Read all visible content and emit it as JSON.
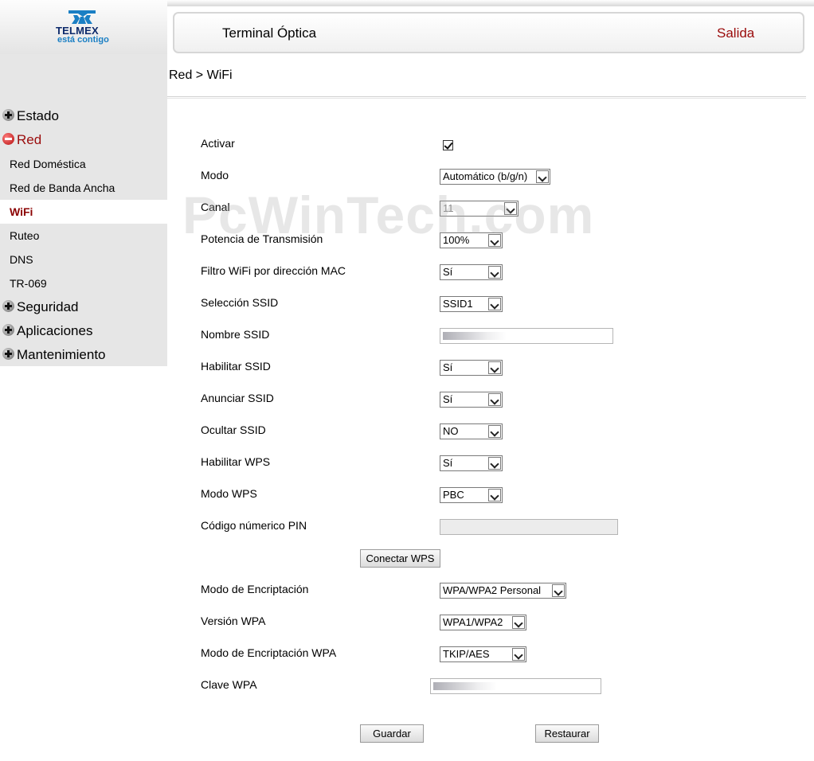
{
  "logo": {
    "brand": "TELMEX",
    "tagline": "está contigo"
  },
  "header": {
    "title": "Terminal Óptica",
    "exit_label": "Salida"
  },
  "breadcrumb": "Red > WiFi",
  "watermark": "PcWinTech.com",
  "nav": {
    "estado": "Estado",
    "red": "Red",
    "red_items": [
      "Red Doméstica",
      "Red de Banda Ancha",
      "WiFi",
      "Ruteo",
      "DNS",
      "TR-069"
    ],
    "seguridad": "Seguridad",
    "aplicaciones": "Aplicaciones",
    "mantenimiento": "Mantenimiento"
  },
  "form": {
    "activar_label": "Activar",
    "activar_checked": true,
    "modo_label": "Modo",
    "modo_value": "Automático (b/g/n)",
    "canal_label": "Canal",
    "canal_value": "11",
    "potencia_label": "Potencia de Transmisión",
    "potencia_value": "100%",
    "filtro_label": "Filtro WiFi por dirección MAC",
    "filtro_value": "Sí",
    "seleccion_label": "Selección SSID",
    "seleccion_value": "SSID1",
    "nombre_label": "Nombre SSID",
    "habilitar_ssid_label": "Habilitar SSID",
    "habilitar_ssid_value": "Sí",
    "anunciar_label": "Anunciar SSID",
    "anunciar_value": "Sí",
    "ocultar_label": "Ocultar SSID",
    "ocultar_value": "NO",
    "habilitar_wps_label": "Habilitar WPS",
    "habilitar_wps_value": "Sí",
    "modo_wps_label": "Modo WPS",
    "modo_wps_value": "PBC",
    "pin_label": "Código númerico PIN",
    "conectar_wps": "Conectar WPS",
    "encript_label": "Modo de Encriptación",
    "encript_value": "WPA/WPA2 Personal",
    "version_label": "Versión WPA",
    "version_value": "WPA1/WPA2",
    "encript_wpa_label": "Modo de Encriptación WPA",
    "encript_wpa_value": "TKIP/AES",
    "clave_label": "Clave WPA",
    "guardar": "Guardar",
    "restaurar": "Restaurar"
  }
}
